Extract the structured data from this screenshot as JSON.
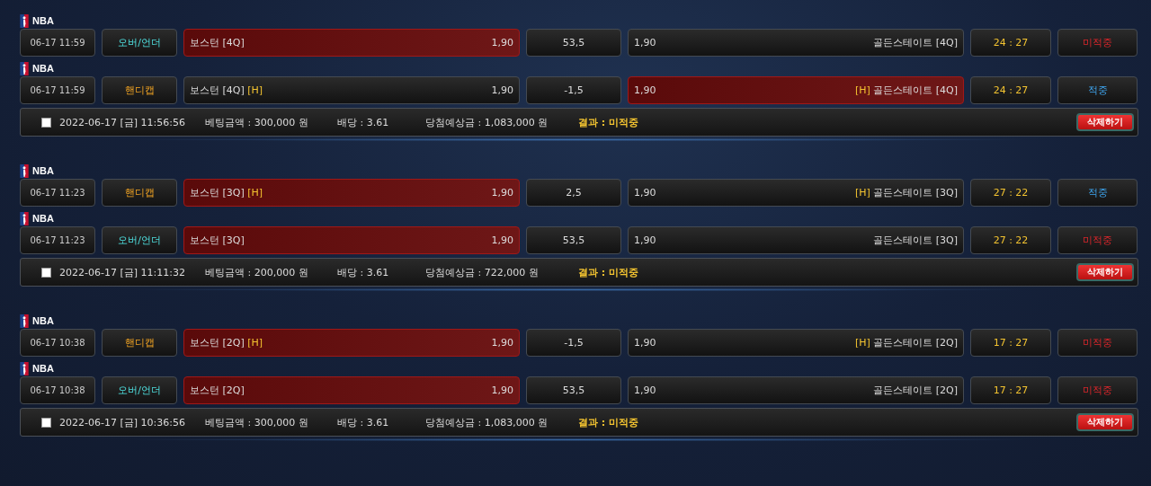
{
  "slips": [
    {
      "bets": [
        {
          "league": "NBA",
          "time": "06-17 11:59",
          "type": {
            "kind": "over_under",
            "label": "오버/언더"
          },
          "home": {
            "name": "보스턴 [4Q]",
            "odds": "1,90",
            "selected": true
          },
          "line": "53,5",
          "away": {
            "odds": "1,90",
            "name": "골든스테이트 [4Q]",
            "selected": false
          },
          "score": "24 : 27",
          "result": {
            "kind": "miss",
            "label": "미적중"
          }
        },
        {
          "league": "NBA",
          "time": "06-17 11:59",
          "type": {
            "kind": "handicap",
            "label": "핸디캡"
          },
          "home": {
            "name": "보스턴 [4Q]",
            "mark": "[H]",
            "odds": "1,90",
            "selected": false
          },
          "line": "-1,5",
          "away": {
            "odds": "1,90",
            "mark": "[H]",
            "name": "골든스테이트 [4Q]",
            "selected": true
          },
          "score": "24 : 27",
          "result": {
            "kind": "hit",
            "label": "적중"
          }
        }
      ],
      "summary": {
        "checked": false,
        "date": "2022-06-17 [금] 11:56:56",
        "amount": "베팅금액 : 300,000 원",
        "odds": "배당 : 3.61",
        "expected": "당첨예상금 : 1,083,000 원",
        "result": "결과 : 미적중",
        "delete": "삭제하기"
      }
    },
    {
      "bets": [
        {
          "league": "NBA",
          "time": "06-17 11:23",
          "type": {
            "kind": "handicap",
            "label": "핸디캡"
          },
          "home": {
            "name": "보스턴 [3Q]",
            "mark": "[H]",
            "odds": "1,90",
            "selected": true
          },
          "line": "2,5",
          "away": {
            "odds": "1,90",
            "mark": "[H]",
            "name": "골든스테이트 [3Q]",
            "selected": false
          },
          "score": "27 : 22",
          "result": {
            "kind": "hit",
            "label": "적중"
          }
        },
        {
          "league": "NBA",
          "time": "06-17 11:23",
          "type": {
            "kind": "over_under",
            "label": "오버/언더"
          },
          "home": {
            "name": "보스턴 [3Q]",
            "odds": "1,90",
            "selected": true
          },
          "line": "53,5",
          "away": {
            "odds": "1,90",
            "name": "골든스테이트 [3Q]",
            "selected": false
          },
          "score": "27 : 22",
          "result": {
            "kind": "miss",
            "label": "미적중"
          }
        }
      ],
      "summary": {
        "checked": false,
        "date": "2022-06-17 [금] 11:11:32",
        "amount": "베팅금액 : 200,000 원",
        "odds": "배당 : 3.61",
        "expected": "당첨예상금 : 722,000 원",
        "result": "결과 : 미적중",
        "delete": "삭제하기"
      }
    },
    {
      "bets": [
        {
          "league": "NBA",
          "time": "06-17 10:38",
          "type": {
            "kind": "handicap",
            "label": "핸디캡"
          },
          "home": {
            "name": "보스턴 [2Q]",
            "mark": "[H]",
            "odds": "1,90",
            "selected": true
          },
          "line": "-1,5",
          "away": {
            "odds": "1,90",
            "mark": "[H]",
            "name": "골든스테이트 [2Q]",
            "selected": false
          },
          "score": "17 : 27",
          "result": {
            "kind": "miss",
            "label": "미적중"
          }
        },
        {
          "league": "NBA",
          "time": "06-17 10:38",
          "type": {
            "kind": "over_under",
            "label": "오버/언더"
          },
          "home": {
            "name": "보스턴 [2Q]",
            "odds": "1,90",
            "selected": true
          },
          "line": "53,5",
          "away": {
            "odds": "1,90",
            "name": "골든스테이트 [2Q]",
            "selected": false
          },
          "score": "17 : 27",
          "result": {
            "kind": "miss",
            "label": "미적중"
          }
        }
      ],
      "summary": {
        "checked": false,
        "date": "2022-06-17 [금] 10:36:56",
        "amount": "베팅금액 : 300,000 원",
        "odds": "배당 : 3.61",
        "expected": "당첨예상금 : 1,083,000 원",
        "result": "결과 : 미적중",
        "delete": "삭제하기"
      }
    }
  ]
}
